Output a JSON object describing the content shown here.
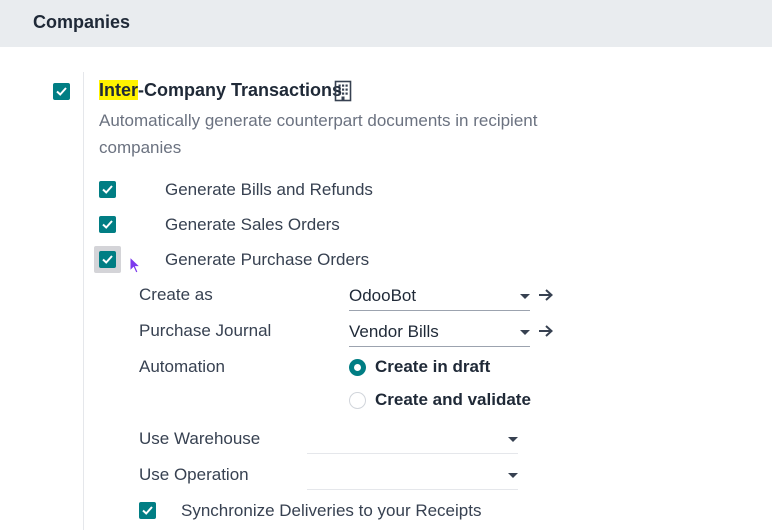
{
  "header": {
    "title": "Companies"
  },
  "feature": {
    "title_highlight": "Inter",
    "title_rest": "-Company Transactions",
    "description": "Automatically generate counterpart documents in recipient companies",
    "enabled": true
  },
  "options": [
    {
      "label": "Generate Bills and Refunds",
      "checked": true
    },
    {
      "label": "Generate Sales Orders",
      "checked": true
    },
    {
      "label": "Generate Purchase Orders",
      "checked": true
    }
  ],
  "fields": {
    "create_as": {
      "label": "Create as",
      "value": "OdooBot"
    },
    "purchase_journal": {
      "label": "Purchase Journal",
      "value": "Vendor Bills"
    },
    "automation": {
      "label": "Automation",
      "options": [
        {
          "label": "Create in draft",
          "selected": true
        },
        {
          "label": "Create and validate",
          "selected": false
        }
      ]
    },
    "use_warehouse": {
      "label": "Use Warehouse",
      "value": ""
    },
    "use_operation": {
      "label": "Use Operation",
      "value": ""
    }
  },
  "sync": {
    "label": "Synchronize Deliveries to your Receipts",
    "checked": true
  },
  "colors": {
    "accent": "#017e84",
    "highlight": "#fff200",
    "header_bg": "#e9ecef"
  },
  "icons": {
    "building": "building-icon",
    "arrow": "arrow-right-icon",
    "caret": "caret-down-icon",
    "cursor": "mouse-cursor-icon"
  }
}
